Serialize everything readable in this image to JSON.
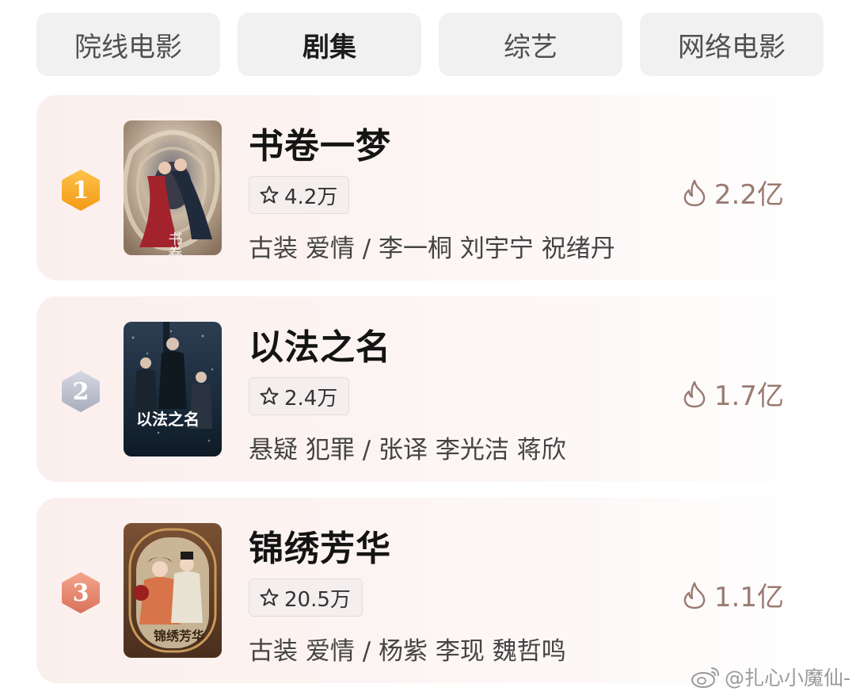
{
  "tabs": [
    {
      "label": "院线电影",
      "active": false
    },
    {
      "label": "剧集",
      "active": true
    },
    {
      "label": "综艺",
      "active": false
    },
    {
      "label": "网络电影",
      "active": false
    }
  ],
  "rankings": [
    {
      "rank": "1",
      "title": "书卷一梦",
      "rating": "4.2万",
      "tags": "古装 爱情 / 李一桐 刘宇宁 祝绪丹",
      "heat": "2.2亿",
      "badge_color": "#f5a623",
      "poster_text": "书卷一梦"
    },
    {
      "rank": "2",
      "title": "以法之名",
      "rating": "2.4万",
      "tags": "悬疑 犯罪 / 张译 李光洁 蒋欣",
      "heat": "1.7亿",
      "badge_color": "#b8bcc8",
      "poster_text": "以法之名"
    },
    {
      "rank": "3",
      "title": "锦绣芳华",
      "rating": "20.5万",
      "tags": "古装 爱情 / 杨紫 李现 魏哲鸣",
      "heat": "1.1亿",
      "badge_color": "#e48a73",
      "poster_text": "锦绣芳华"
    }
  ],
  "watermark": "@扎心小魔仙-",
  "icons": {
    "rating": "star-outline-icon",
    "heat": "flame-outline-icon",
    "watermark": "weibo-logo-icon"
  }
}
